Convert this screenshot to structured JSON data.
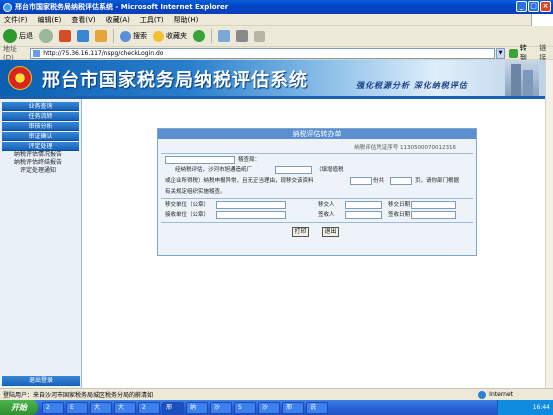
{
  "window": {
    "title": "邢台市国家税务局纳税评估系统 - Microsoft Internet Explorer"
  },
  "menu": [
    "文件(F)",
    "编辑(E)",
    "查看(V)",
    "收藏(A)",
    "工具(T)",
    "帮助(H)"
  ],
  "toolbar": {
    "back": "后退",
    "search": "搜索",
    "favorites": "收藏夹"
  },
  "address": {
    "label": "地址(D)",
    "url": "http://75.36.16.117/nspg/checkLogin.do",
    "go": "转到",
    "links": "链接"
  },
  "banner": {
    "title": "邢台市国家税务局纳税评估系统",
    "slogan": "强化税源分析   深化纳税评估"
  },
  "sidebar": {
    "items": [
      "业务查询",
      "任务流转",
      "审核分析",
      "审证确认",
      "评定处理"
    ],
    "subitems": [
      "纳税评估情况报告",
      "纳税评估终结报告",
      "评定处理通知"
    ],
    "logout": "退出登录"
  },
  "form": {
    "header": "纳税评估转办单",
    "code_label": "纳税评估凭证序号",
    "code_value": "1130500070012316",
    "bureau_suffix": "稽查局：",
    "line2a": "经纳税评估，沙河市旭通造纸厂",
    "line2b": "（填增值税",
    "line3a": "或企业所得税）纳税申报异常，且无正当理由，现移交该资料",
    "line3b": "份共",
    "line3c": "页，请你部门根据",
    "line4": "有关规定组织实施稽查。",
    "sender_unit": "移交单位（公章）",
    "sender": "移交人",
    "send_date": "移交日期",
    "receiver_unit": "接收单位（公章）",
    "signer": "签收人",
    "sign_date": "签收日期",
    "print": "打印",
    "exit": "退出"
  },
  "status": {
    "text": "登陆用户：来自沙河市国家税务局城区税务分局的蔚清如",
    "zone": "Internet"
  },
  "taskbar": {
    "start": "开始",
    "tasks": [
      "2",
      "E",
      "大",
      "大",
      "2",
      "邢",
      "纳",
      "沙",
      "S",
      "沙",
      "邢",
      "说"
    ],
    "clock": "16:44"
  }
}
